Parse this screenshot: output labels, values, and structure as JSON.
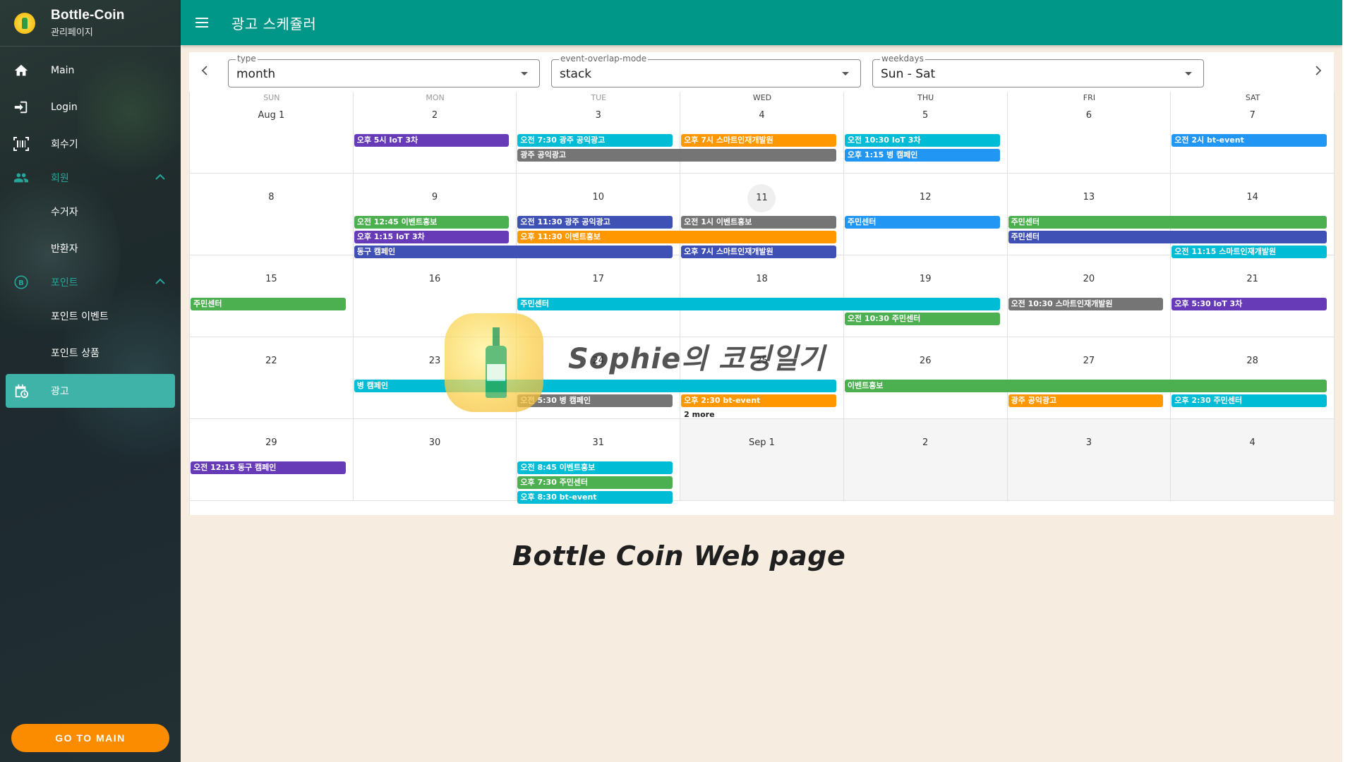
{
  "sidebar": {
    "brand_title": "Bottle-Coin",
    "brand_subtitle": "관리페이지",
    "items": [
      {
        "label": "Main",
        "icon": "home-icon"
      },
      {
        "label": "Login",
        "icon": "login-icon"
      },
      {
        "label": "회수기",
        "icon": "barcode-icon"
      }
    ],
    "group_members": {
      "label": "회원",
      "icon": "people-icon",
      "children": [
        "수거자",
        "반환자"
      ]
    },
    "group_points": {
      "label": "포인트",
      "icon": "bitcoin-icon",
      "children": [
        "포인트 이벤트",
        "포인트 상품"
      ]
    },
    "active_item": {
      "label": "광고",
      "icon": "calendar-clock-icon"
    },
    "go_main_label": "GO TO MAIN"
  },
  "appbar": {
    "title": "광고 스케쥴러"
  },
  "toolbar": {
    "type": {
      "label": "type",
      "value": "month"
    },
    "overlap": {
      "label": "event-overlap-mode",
      "value": "stack"
    },
    "weekdays": {
      "label": "weekdays",
      "value": "Sun - Sat"
    }
  },
  "calendar": {
    "weekdays": [
      "SUN",
      "MON",
      "TUE",
      "WED",
      "THU",
      "FRI",
      "SAT"
    ],
    "weeks": [
      [
        "Aug 1",
        "2",
        "3",
        "4",
        "5",
        "6",
        "7"
      ],
      [
        "8",
        "9",
        "10",
        "11",
        "12",
        "13",
        "14"
      ],
      [
        "15",
        "16",
        "17",
        "18",
        "19",
        "20",
        "21"
      ],
      [
        "22",
        "23",
        "24",
        "25",
        "26",
        "27",
        "28"
      ],
      [
        "29",
        "30",
        "31",
        "Sep 1",
        "2",
        "3",
        "4"
      ]
    ],
    "today_label": "11",
    "events": [
      {
        "week": 0,
        "start": 1,
        "span": 1,
        "slot": 0,
        "text": "오후 5시 IoT 3차",
        "color": "#673ab7"
      },
      {
        "week": 0,
        "start": 2,
        "span": 1,
        "slot": 0,
        "text": "오전 7:30 광주 공익광고",
        "color": "#00bcd4"
      },
      {
        "week": 0,
        "start": 2,
        "span": 2,
        "slot": 1,
        "text": "광주 공익광고",
        "color": "#757575"
      },
      {
        "week": 0,
        "start": 3,
        "span": 1,
        "slot": 0,
        "text": "오후 7시 스마트인재개발원",
        "color": "#ff9800"
      },
      {
        "week": 0,
        "start": 4,
        "span": 1,
        "slot": 0,
        "text": "오전 10:30 IoT 3차",
        "color": "#00bcd4"
      },
      {
        "week": 0,
        "start": 4,
        "span": 1,
        "slot": 1,
        "text": "오후 1:15 병 캠페인",
        "color": "#2196f3"
      },
      {
        "week": 0,
        "start": 6,
        "span": 1,
        "slot": 0,
        "text": "오전 2시 bt-event",
        "color": "#2196f3"
      },
      {
        "week": 1,
        "start": 1,
        "span": 1,
        "slot": 0,
        "text": "오전 12:45 이벤트홍보",
        "color": "#4caf50"
      },
      {
        "week": 1,
        "start": 1,
        "span": 1,
        "slot": 1,
        "text": "오후 1:15 IoT 3차",
        "color": "#673ab7"
      },
      {
        "week": 1,
        "start": 1,
        "span": 2,
        "slot": 2,
        "text": "동구 캠페인",
        "color": "#3f51b5"
      },
      {
        "week": 1,
        "start": 2,
        "span": 1,
        "slot": 0,
        "text": "오전 11:30 광주 공익광고",
        "color": "#3f51b5"
      },
      {
        "week": 1,
        "start": 2,
        "span": 2,
        "slot": 1,
        "text": "오후 11:30 이벤트홍보",
        "color": "#ff9800"
      },
      {
        "week": 1,
        "start": 3,
        "span": 1,
        "slot": 0,
        "text": "오전 1시 이벤트홍보",
        "color": "#757575"
      },
      {
        "week": 1,
        "start": 3,
        "span": 1,
        "slot": 2,
        "text": "오후 7시 스마트인재개발원",
        "color": "#3f51b5"
      },
      {
        "week": 1,
        "start": 4,
        "span": 1,
        "slot": 0,
        "text": "주민센터",
        "color": "#2196f3"
      },
      {
        "week": 1,
        "start": 5,
        "span": 2,
        "slot": 0,
        "text": "주민센터",
        "color": "#4caf50"
      },
      {
        "week": 1,
        "start": 5,
        "span": 2,
        "slot": 1,
        "text": "주민센터",
        "color": "#3f51b5"
      },
      {
        "week": 1,
        "start": 6,
        "span": 1,
        "slot": 2,
        "text": "오전 11:15 스마트인재개발원",
        "color": "#00bcd4"
      },
      {
        "week": 2,
        "start": 0,
        "span": 1,
        "slot": 0,
        "text": "주민센터",
        "color": "#4caf50"
      },
      {
        "week": 2,
        "start": 2,
        "span": 3,
        "slot": 0,
        "text": "주민센터",
        "color": "#00bcd4"
      },
      {
        "week": 2,
        "start": 4,
        "span": 1,
        "slot": 1,
        "text": "오전 10:30 주민센터",
        "color": "#4caf50"
      },
      {
        "week": 2,
        "start": 5,
        "span": 1,
        "slot": 0,
        "text": "오전 10:30 스마트인재개발원",
        "color": "#757575"
      },
      {
        "week": 2,
        "start": 6,
        "span": 1,
        "slot": 0,
        "text": "오후 5:30 IoT 3차",
        "color": "#673ab7"
      },
      {
        "week": 3,
        "start": 1,
        "span": 3,
        "slot": 0,
        "text": "병 캠페인",
        "color": "#00bcd4"
      },
      {
        "week": 3,
        "start": 2,
        "span": 1,
        "slot": 1,
        "text": "오전 5:30 병 캠페인",
        "color": "#757575"
      },
      {
        "week": 3,
        "start": 3,
        "span": 1,
        "slot": 1,
        "text": "오후 2:30 bt-event",
        "color": "#ff9800"
      },
      {
        "week": 3,
        "start": 4,
        "span": 3,
        "slot": 0,
        "text": "이벤트홍보",
        "color": "#4caf50"
      },
      {
        "week": 3,
        "start": 5,
        "span": 1,
        "slot": 1,
        "text": "광주 공익광고",
        "color": "#ff9800"
      },
      {
        "week": 3,
        "start": 6,
        "span": 1,
        "slot": 1,
        "text": "오후 2:30 주민센터",
        "color": "#00bcd4"
      },
      {
        "week": 4,
        "start": 0,
        "span": 1,
        "slot": 0,
        "text": "오전 12:15 동구 캠페인",
        "color": "#673ab7"
      },
      {
        "week": 4,
        "start": 2,
        "span": 1,
        "slot": 0,
        "text": "오전 8:45 이벤트홍보",
        "color": "#00bcd4"
      },
      {
        "week": 4,
        "start": 2,
        "span": 1,
        "slot": 1,
        "text": "오후 7:30 주민센터",
        "color": "#4caf50"
      },
      {
        "week": 4,
        "start": 2,
        "span": 1,
        "slot": 2,
        "text": "오후 8:30 bt-event",
        "color": "#00bcd4"
      }
    ],
    "more": [
      {
        "week": 3,
        "col": 3,
        "text": "2 more"
      }
    ]
  },
  "watermark": {
    "text": "Sophie의 코딩일기"
  },
  "footer": {
    "title": "Bottle Coin Web page"
  }
}
